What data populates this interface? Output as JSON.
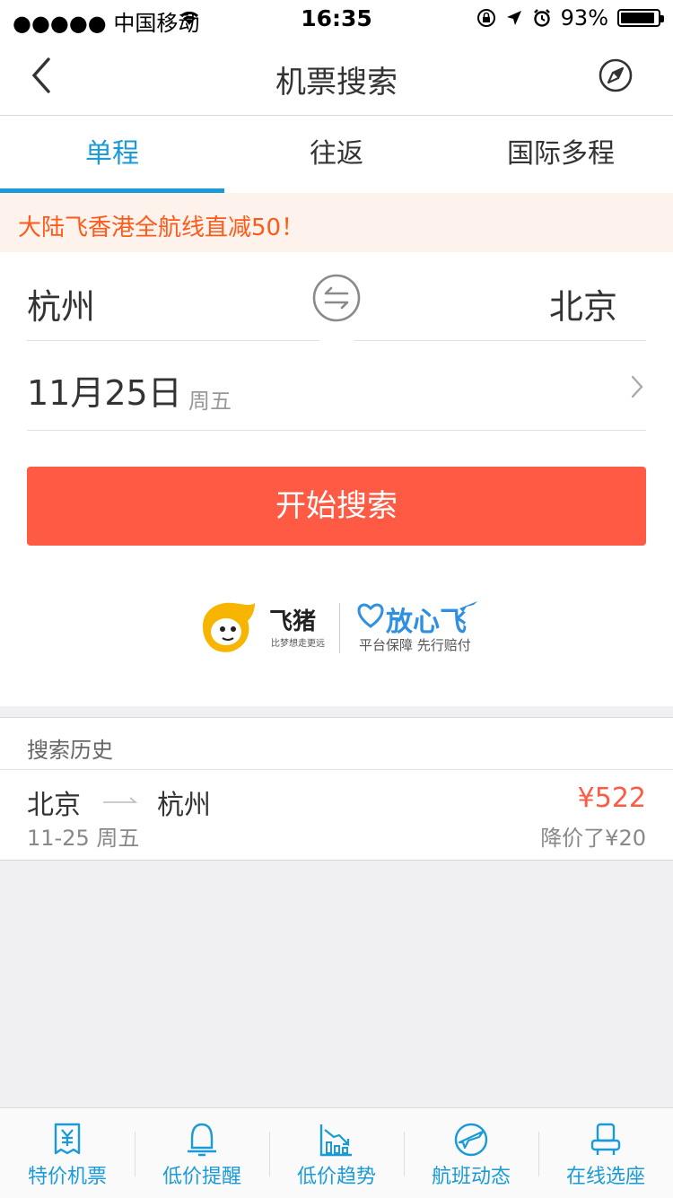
{
  "status_bar": {
    "carrier": "●●●●● 中国移动",
    "time": "16:35",
    "battery": "93%",
    "battery_level": 0.93
  },
  "nav": {
    "title": "机票搜索",
    "back_icon": "chevron-left-icon",
    "compass_icon": "compass-icon"
  },
  "tabs": [
    {
      "label": "单程",
      "active": true
    },
    {
      "label": "往返",
      "active": false
    },
    {
      "label": "国际多程",
      "active": false
    }
  ],
  "promo": {
    "text": "大陆飞香港全航线直减50！"
  },
  "search": {
    "from_city": "杭州",
    "to_city": "北京",
    "date": "11月25日",
    "weekday": "周五",
    "button_label": "开始搜索"
  },
  "brand": {
    "name": "飞猪",
    "slogan": "比梦想走更远",
    "assurance_title": "放心飞",
    "assurance_sub": "平台保障 先行赔付"
  },
  "history": {
    "label": "搜索历史",
    "items": [
      {
        "from": "北京",
        "to": "杭州",
        "date": "11-25 周五",
        "price": "¥522",
        "drop": "降价了¥20"
      }
    ]
  },
  "tabbar": [
    {
      "label": "特价机票",
      "icon": "ticket-yen-icon"
    },
    {
      "label": "低价提醒",
      "icon": "bell-icon"
    },
    {
      "label": "低价趋势",
      "icon": "trend-chart-icon"
    },
    {
      "label": "航班动态",
      "icon": "plane-icon"
    },
    {
      "label": "在线选座",
      "icon": "seat-icon"
    }
  ],
  "colors": {
    "accent": "#1a9ad6",
    "primary_button": "#ff5a43",
    "promo_text": "#ff5a1a",
    "brand_yellow": "#f7b500",
    "assurance_blue": "#2f8fe0"
  }
}
